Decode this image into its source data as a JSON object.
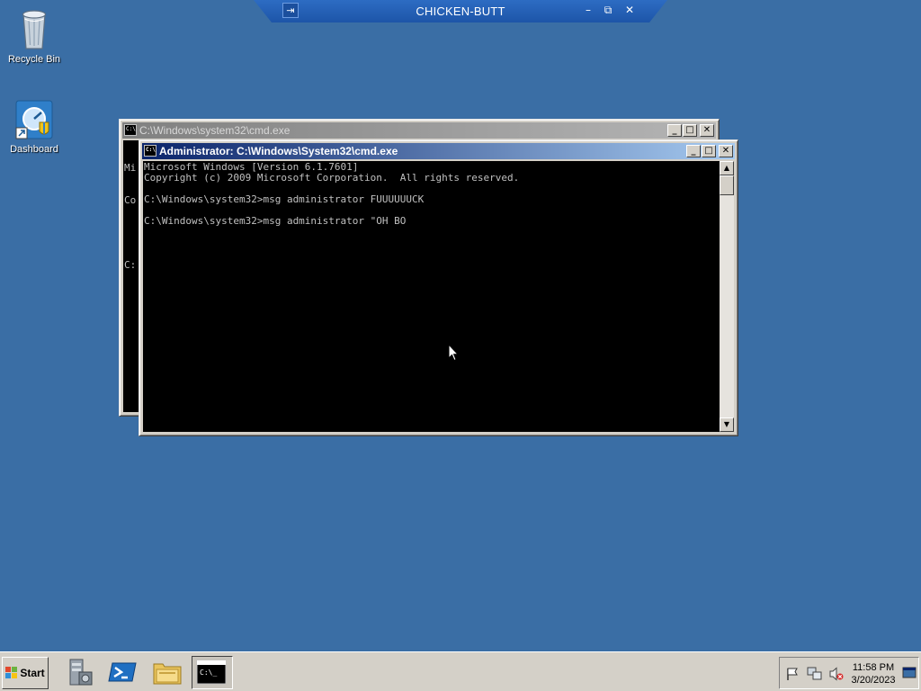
{
  "rdp_bar": {
    "title": "CHICKEN-BUTT",
    "pin_glyph": "⇥",
    "minimize_glyph": "–",
    "restore_glyph": "⧉",
    "close_glyph": "✕"
  },
  "desktop": {
    "icons": [
      {
        "label": "Recycle Bin",
        "icon": "recycle-bin-icon"
      },
      {
        "label": "Dashboard",
        "icon": "dashboard-icon"
      }
    ]
  },
  "back_window": {
    "title": "C:\\Windows\\system32\\cmd.exe",
    "icon_text": "C:\\",
    "visible_lines": [
      "Mi",
      "Co",
      "",
      "C:"
    ]
  },
  "front_window": {
    "title": "Administrator: C:\\Windows\\System32\\cmd.exe",
    "icon_text": "C:\\",
    "console_text": "Microsoft Windows [Version 6.1.7601]\nCopyright (c) 2009 Microsoft Corporation.  All rights reserved.\n\nC:\\Windows\\system32>msg administrator FUUUUUUCK\n\nC:\\Windows\\system32>msg administrator \"OH BO"
  },
  "window_buttons": {
    "minimize": "_",
    "maximize": "□",
    "close": "✕"
  },
  "scrollbar": {
    "up": "▲",
    "down": "▼"
  },
  "taskbar": {
    "start_label": "Start",
    "quick_launch": [
      "server-manager-icon",
      "powershell-icon",
      "explorer-folder-icon"
    ],
    "active_task": "cmd-task-icon",
    "tray_icons": [
      "action-center-flag-icon",
      "network-icon",
      "volume-muted-icon",
      "show-desktop-icon"
    ],
    "clock_time": "11:58 PM",
    "clock_date": "3/20/2023"
  },
  "colors": {
    "desktop": "#3a6ea5",
    "active_title": "#0a246a",
    "inactive_title": "#808080",
    "console_bg": "#000000",
    "console_fg": "#c0c0c0"
  }
}
